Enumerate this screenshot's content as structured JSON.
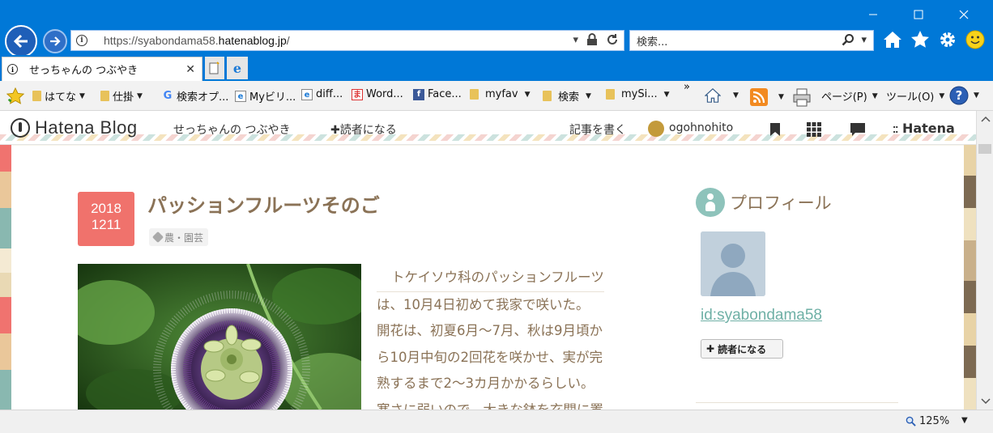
{
  "browser": {
    "url_prefix": "https://syabondama58.",
    "url_domain": "hatenablog.jp",
    "url_suffix": "/",
    "search_placeholder": "検索...",
    "tab_title": "せっちゃんの つぶやき",
    "zoom": "125%"
  },
  "favorites": [
    {
      "label": "はてな",
      "icon": "folder-icon",
      "menu": true
    },
    {
      "label": "仕掛",
      "icon": "folder-icon",
      "menu": true
    },
    {
      "label": "検索オプ...",
      "icon": "google-icon",
      "menu": false
    },
    {
      "label": "Myビリ...",
      "icon": "ie-page-icon",
      "menu": false
    },
    {
      "label": "diff...",
      "icon": "ie-page-icon",
      "menu": false
    },
    {
      "label": "Word...",
      "icon": "ma-icon",
      "menu": false
    },
    {
      "label": "Face...",
      "icon": "facebook-icon",
      "menu": false
    },
    {
      "label": "myfav",
      "icon": "folder-icon",
      "menu": true
    },
    {
      "label": "検索",
      "icon": "folder-icon",
      "menu": true
    },
    {
      "label": "mySi...",
      "icon": "folder-icon",
      "menu": true
    }
  ],
  "command_bar": {
    "overflow": "»",
    "page_menu": "ページ(P)",
    "tools_menu": "ツール(O)"
  },
  "hatena_bar": {
    "logo": "Hatena Blog",
    "blog_name": "せっちゃんの つぶやき",
    "subscribe": "読者になる",
    "write": "記事を書く",
    "user": "ogohnohito",
    "brand": "Hatena"
  },
  "post": {
    "date_year": "2018",
    "date_md": "1211",
    "title": "パッションフルーツそのご",
    "tag": "農・園芸",
    "body_lines": [
      "トケイソウ科のパッションフルーツ",
      "は、10月4日初めて我家で咲いた。",
      "開花は、初夏6月～7月、秋は9月頃か",
      "ら10月中旬の2回花を咲かせ、実が完",
      "熟するまで2～3カ月かかるらしい。",
      "寒さに弱いので、大きな鉢を玄関に置"
    ]
  },
  "sidebar": {
    "profile_title": "プロフィール",
    "user_id": "id:syabondama58",
    "subscribe_button": "読者になる"
  }
}
